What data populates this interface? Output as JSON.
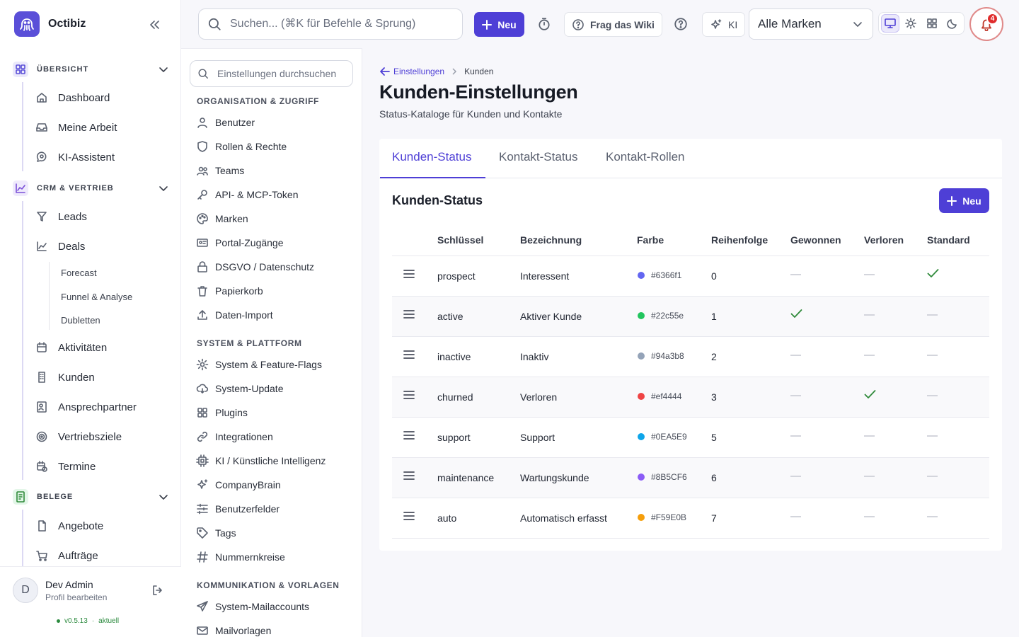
{
  "app": {
    "name": "Octibiz",
    "version": "v0.5.13",
    "version_status": "aktuell"
  },
  "topbar": {
    "search_placeholder": "Suchen... (⌘K für Befehle & Sprung)",
    "new_label": "Neu",
    "wiki_label": "Frag das Wiki",
    "ki_label": "KI",
    "brand_select": "Alle Marken",
    "notifications_count": "4"
  },
  "sidebar": {
    "sections": [
      {
        "label": "ÜBERSICHT",
        "items": [
          "Dashboard",
          "Meine Arbeit",
          "KI-Assistent"
        ]
      },
      {
        "label": "CRM & VERTRIEB",
        "items": [
          "Leads",
          "Deals",
          "Aktivitäten",
          "Kunden",
          "Ansprechpartner",
          "Vertriebsziele",
          "Termine"
        ],
        "deal_subitems": [
          "Forecast",
          "Funnel & Analyse",
          "Dubletten"
        ]
      },
      {
        "label": "BELEGE",
        "items": [
          "Angebote",
          "Aufträge"
        ]
      }
    ],
    "user": {
      "initial": "D",
      "name": "Dev Admin",
      "sub": "Profil bearbeiten"
    }
  },
  "settings_nav": {
    "search_placeholder": "Einstellungen durchsuchen",
    "groups": [
      {
        "label": "ORGANISATION & ZUGRIFF",
        "items": [
          "Benutzer",
          "Rollen & Rechte",
          "Teams",
          "API- & MCP-Token",
          "Marken",
          "Portal-Zugänge",
          "DSGVO / Datenschutz",
          "Papierkorb",
          "Daten-Import"
        ]
      },
      {
        "label": "SYSTEM & PLATTFORM",
        "items": [
          "System & Feature-Flags",
          "System-Update",
          "Plugins",
          "Integrationen",
          "KI / Künstliche Intelligenz",
          "CompanyBrain",
          "Benutzerfelder",
          "Tags",
          "Nummernkreise"
        ]
      },
      {
        "label": "KOMMUNIKATION & VORLAGEN",
        "items": [
          "System-Mailaccounts",
          "Mailvorlagen"
        ]
      }
    ]
  },
  "page": {
    "breadcrumb_parent": "Einstellungen",
    "breadcrumb_current": "Kunden",
    "title": "Kunden-Einstellungen",
    "subtitle": "Status-Kataloge für Kunden und Kontakte",
    "tabs": [
      "Kunden-Status",
      "Kontakt-Status",
      "Kontakt-Rollen"
    ],
    "active_tab": 0,
    "section_title": "Kunden-Status",
    "section_new": "Neu",
    "columns": [
      "Schlüssel",
      "Bezeichnung",
      "Farbe",
      "Reihenfolge",
      "Gewonnen",
      "Verloren",
      "Standard"
    ],
    "rows": [
      {
        "key": "prospect",
        "label": "Interessent",
        "color": "#6366f1",
        "order": "0",
        "won": false,
        "lost": false,
        "default": true
      },
      {
        "key": "active",
        "label": "Aktiver Kunde",
        "color": "#22c55e",
        "order": "1",
        "won": true,
        "lost": false,
        "default": false
      },
      {
        "key": "inactive",
        "label": "Inaktiv",
        "color": "#94a3b8",
        "order": "2",
        "won": false,
        "lost": false,
        "default": false
      },
      {
        "key": "churned",
        "label": "Verloren",
        "color": "#ef4444",
        "order": "3",
        "won": false,
        "lost": true,
        "default": false
      },
      {
        "key": "support",
        "label": "Support",
        "color": "#0EA5E9",
        "order": "5",
        "won": false,
        "lost": false,
        "default": false
      },
      {
        "key": "maintenance",
        "label": "Wartungskunde",
        "color": "#8B5CF6",
        "order": "6",
        "won": false,
        "lost": false,
        "default": false
      },
      {
        "key": "auto",
        "label": "Automatisch erfasst",
        "color": "#F59E0B",
        "order": "7",
        "won": false,
        "lost": false,
        "default": false
      }
    ]
  },
  "colors": {
    "accent": "#4e3fd6",
    "check": "#2f8a3a"
  }
}
